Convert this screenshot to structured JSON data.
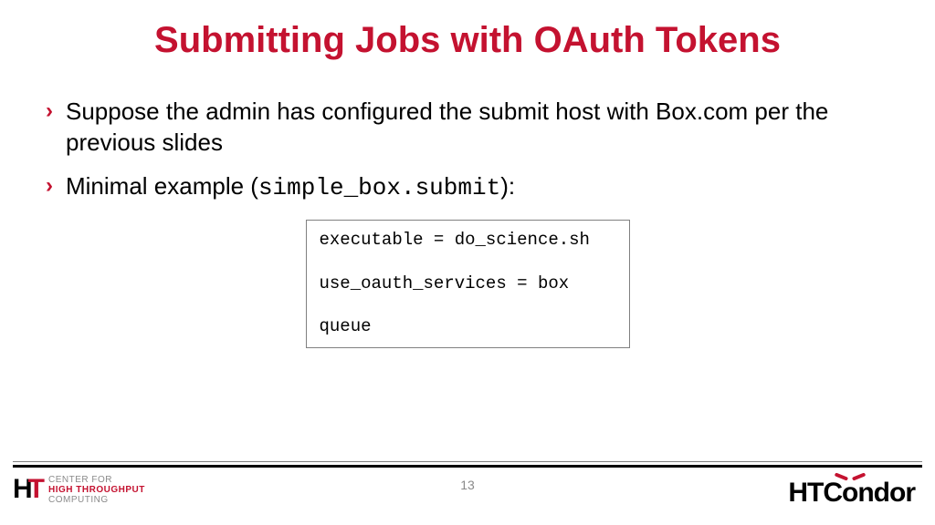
{
  "title": "Submitting Jobs with OAuth Tokens",
  "bullets": [
    {
      "text": "Suppose the admin has configured the submit host with Box.com per the previous slides"
    },
    {
      "prefix": "Minimal example (",
      "code": "simple_box.submit",
      "suffix": "):"
    }
  ],
  "code": {
    "l1": "executable = do_science.sh",
    "l2": "",
    "l3": "use_oauth_services = box",
    "l4": "",
    "l5": "queue"
  },
  "page_number": "13",
  "logo_left": {
    "ht": "HT",
    "line1": "CENTER FOR",
    "line2": "HIGH THROUGHPUT",
    "line3": "COMPUTING"
  },
  "logo_right": {
    "part1": "HTC",
    "o": "o",
    "part2": "ndor"
  }
}
